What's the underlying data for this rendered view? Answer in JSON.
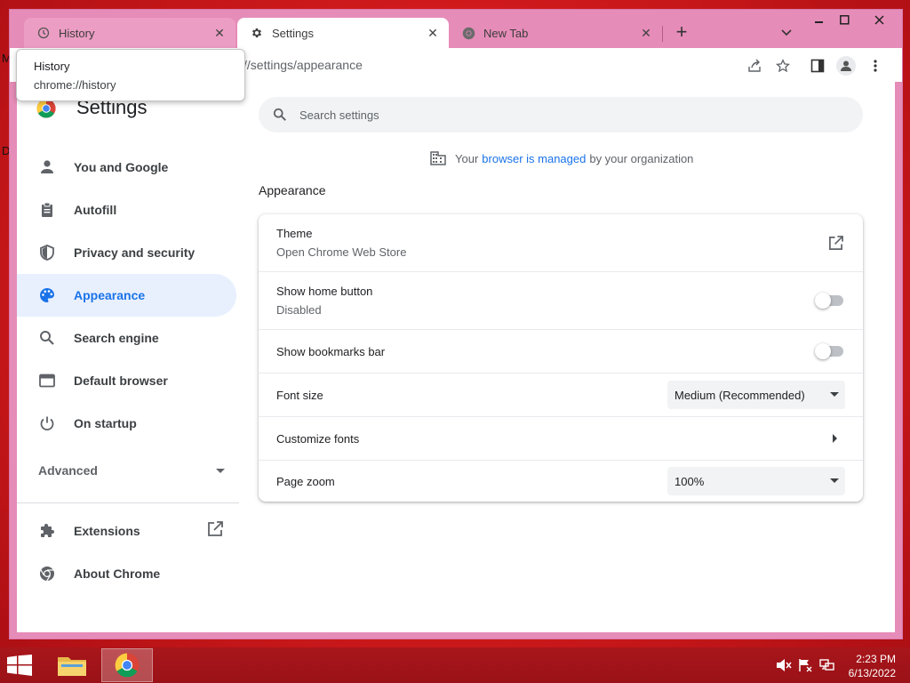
{
  "desktop": {
    "left_char_top": "M",
    "left_char_mid": "D"
  },
  "tabs": [
    {
      "title": "History",
      "icon": "history-icon",
      "close": "✕"
    },
    {
      "title": "Settings",
      "icon": "gear-icon",
      "close": "✕"
    },
    {
      "title": "New Tab",
      "icon": "chrome-icon",
      "close": "✕"
    }
  ],
  "new_tab_label": "+",
  "tooltip": {
    "title": "History",
    "url": "chrome://history"
  },
  "omnibox": {
    "text": "//settings/appearance"
  },
  "sidebar": {
    "title": "Settings",
    "items": [
      {
        "label": "You and Google",
        "icon": "person-icon"
      },
      {
        "label": "Autofill",
        "icon": "clipboard-icon"
      },
      {
        "label": "Privacy and security",
        "icon": "shield-icon"
      },
      {
        "label": "Appearance",
        "icon": "palette-icon",
        "selected": true
      },
      {
        "label": "Search engine",
        "icon": "search-icon"
      },
      {
        "label": "Default browser",
        "icon": "browser-icon"
      },
      {
        "label": "On startup",
        "icon": "power-icon"
      }
    ],
    "advanced": "Advanced",
    "extensions": "Extensions",
    "about": "About Chrome"
  },
  "search": {
    "placeholder": "Search settings"
  },
  "managed": {
    "prefix": "Your",
    "link": "browser is managed",
    "suffix": "by your organization"
  },
  "section_title": "Appearance",
  "appearance": {
    "theme": {
      "label": "Theme",
      "sub": "Open Chrome Web Store"
    },
    "home_button": {
      "label": "Show home button",
      "sub": "Disabled",
      "enabled": false
    },
    "bookmarks_bar": {
      "label": "Show bookmarks bar",
      "enabled": false
    },
    "font_size": {
      "label": "Font size",
      "value": "Medium (Recommended)"
    },
    "customize_fonts": {
      "label": "Customize fonts"
    },
    "page_zoom": {
      "label": "Page zoom",
      "value": "100%"
    }
  },
  "taskbar": {
    "time": "2:23 PM",
    "date": "6/13/2022"
  },
  "colors": {
    "accent": "#1a73e8",
    "frame": "#e68cb8",
    "desktop": "#d11a1c",
    "taskbar": "#a8161b"
  }
}
